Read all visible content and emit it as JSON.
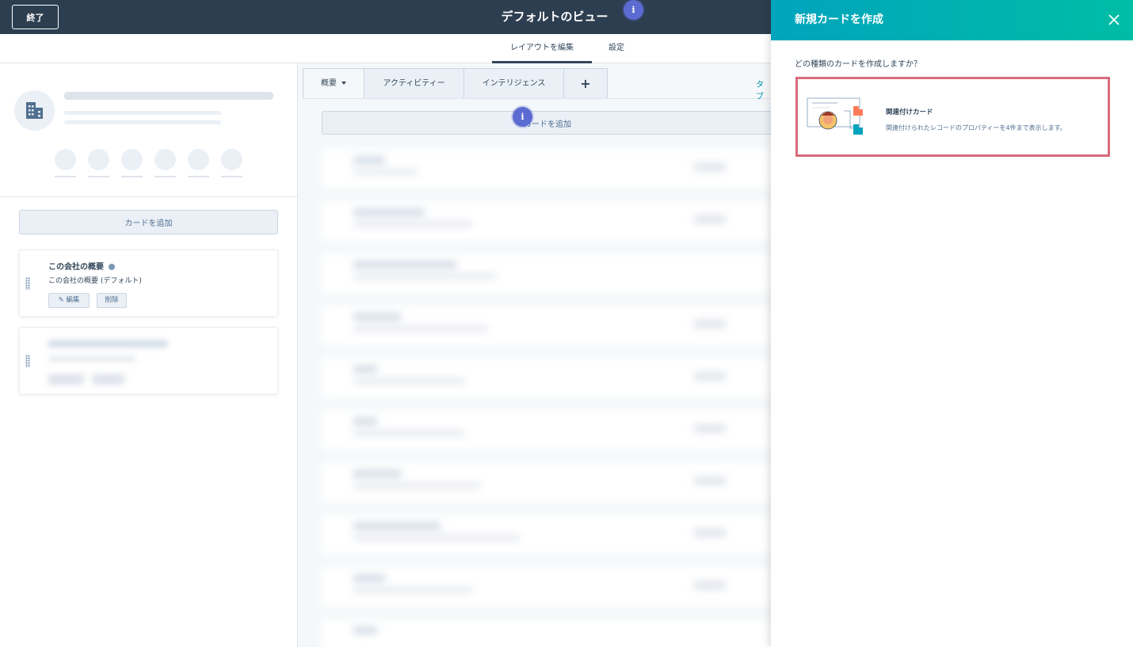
{
  "topbar": {
    "exit_label": "終了",
    "view_title": "デフォルトのビュー",
    "info_marker": "i"
  },
  "subtabs": [
    {
      "label": "レイアウトを編集",
      "active": true
    },
    {
      "label": "設定",
      "active": false
    }
  ],
  "left": {
    "add_card_label": "カードを追加",
    "cards": [
      {
        "title": "この会社の概要",
        "description": "この会社の概要 (デフォルト)",
        "edit_label": "編集",
        "delete_label": "削除"
      }
    ]
  },
  "center": {
    "tabs": [
      {
        "label": "概要"
      },
      {
        "label": "アクティビティー"
      },
      {
        "label": "インテリジェンス"
      },
      {
        "label": "+"
      }
    ],
    "tab_link": "タブ",
    "add_card_label": "カードを追加",
    "info_marker": "i"
  },
  "panel": {
    "title": "新規カードを作成",
    "question": "どの種類のカードを作成しますか？",
    "option": {
      "title": "関連付けカード",
      "description": "関連付けられたレコードのプロパティーを4件まで表示します。"
    }
  },
  "colors": {
    "topbar": "#2d3e50",
    "panel_header_start": "#00a4bd",
    "panel_header_end": "#00bda5",
    "selected_border": "#d76b7c",
    "info_dot": "#5c6bd1"
  }
}
